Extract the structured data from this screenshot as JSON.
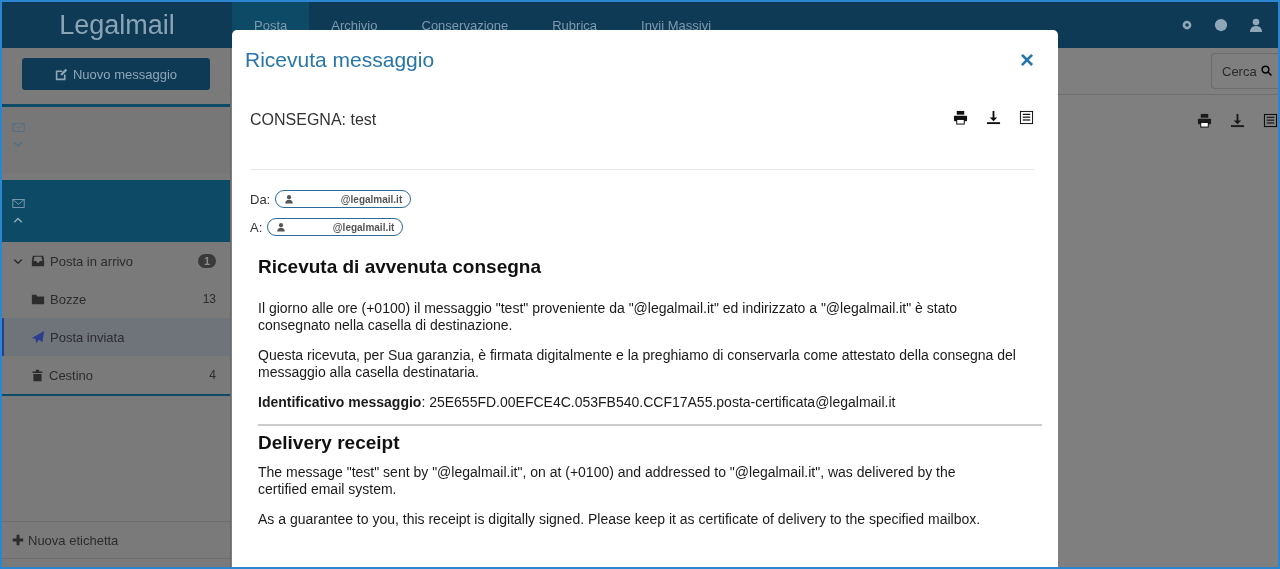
{
  "navbar": {
    "logo": "Legalmail",
    "tabs": [
      {
        "label": "Posta",
        "selected": true
      },
      {
        "label": "Archivio",
        "selected": false
      },
      {
        "label": "Conservazione",
        "selected": false
      },
      {
        "label": "Rubrica",
        "selected": false
      },
      {
        "label": "Invii Massivi",
        "selected": false
      }
    ]
  },
  "sidebar": {
    "new_message": "Nuovo messaggio",
    "accounts": [
      {
        "expanded": false
      },
      {
        "expanded": true
      }
    ],
    "folders": [
      {
        "label": "Posta in arrivo",
        "count": "1",
        "badge": true,
        "expanded": true,
        "selected": false
      },
      {
        "label": "Bozze",
        "count": "13",
        "badge": false,
        "expanded": false,
        "selected": false
      },
      {
        "label": "Posta inviata",
        "expanded": false,
        "selected": true
      },
      {
        "label": "Cestino",
        "count": "4",
        "badge": false,
        "expanded": false,
        "selected": false
      }
    ],
    "new_label": "Nuova etichetta"
  },
  "search": {
    "placeholder": "Cerca"
  },
  "modal": {
    "title": "Ricevuta messaggio",
    "close": "×",
    "subject": "CONSEGNA: test",
    "from": {
      "label": "Da:",
      "address": "@legalmail.it"
    },
    "to": {
      "label": "A:",
      "address": "@legalmail.it"
    },
    "sections": [
      {
        "heading": "Ricevuta di avvenuta consegna",
        "paragraphs": [
          "Il giorno alle ore (+0100) il messaggio \"test\" proveniente da \"@legalmail.it\" ed indirizzato a \"@legalmail.it\" è stato consegnato nella casella di destinazione.",
          "Questa ricevuta, per Sua garanzia, è firmata digitalmente e la preghiamo di conservarla come attestato della consegna del messaggio alla casella destinataria.",
          "**Identificativo messaggio**: 25E655FD.00EFCE4C.053FB540.CCF17A55.posta-certificata@legalmail.it"
        ]
      },
      {
        "heading": "Delivery receipt",
        "paragraphs": [
          "The message \"test\" sent by \"@legalmail.it\", on at (+0100) and addressed to \"@legalmail.it\", was delivered by the certified email system.",
          "As a guarantee to you, this receipt is digitally signed. Please keep it as certificate of delivery to the specified mailbox."
        ]
      }
    ]
  }
}
